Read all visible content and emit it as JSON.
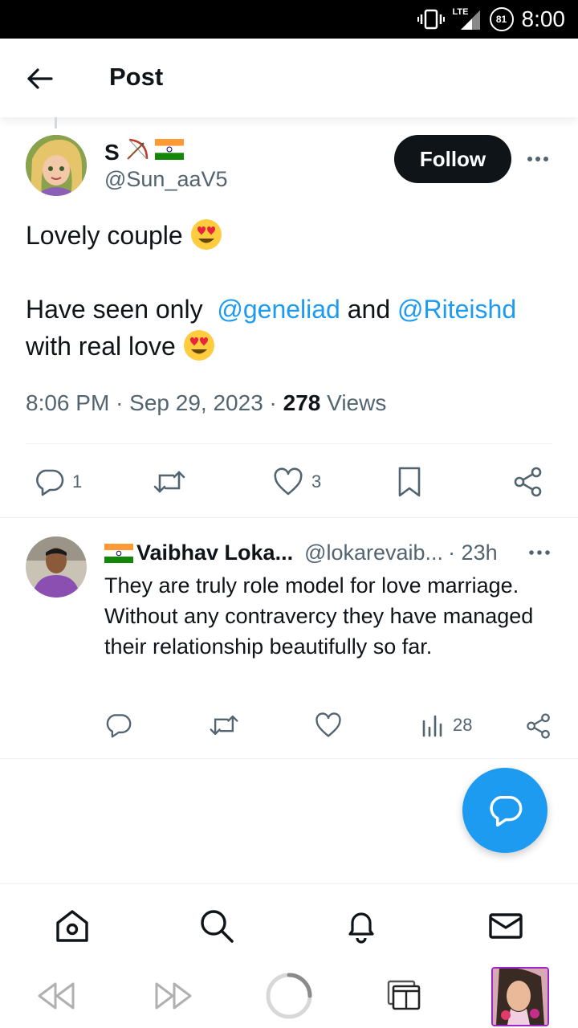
{
  "status_bar": {
    "network_label": "LTE",
    "battery_level": "81",
    "time": "8:00"
  },
  "header": {
    "title": "Post",
    "back_icon": "arrow-left-icon"
  },
  "post": {
    "author_name": "S",
    "author_handle": "@Sun_aaV5",
    "follow_label": "Follow",
    "line1": "Lovely couple",
    "line2_prefix": "Have seen only",
    "mention1": "@geneliad",
    "line2_mid": "and",
    "mention2": "@Riteishd",
    "line3": "with real love",
    "time": "8:06 PM",
    "sep1": "·",
    "date": "Sep 29, 2023",
    "sep2": "·",
    "views_count": "278",
    "views_label": "Views",
    "actions": {
      "reply_count": "1",
      "retweet_count": "",
      "like_count": "3"
    }
  },
  "reply": {
    "name": "Vaibhav Loka...",
    "handle": "@lokarevaib...",
    "time": "· 23h",
    "text": "They are truly role model for love marriage. Without any contravercy they have managed their relationship beautifully so far.",
    "views_count": "28"
  },
  "colors": {
    "accent": "#1d9bf0",
    "text_primary": "#0f1419",
    "text_secondary": "#536471",
    "thumb_border": "#9b27c9"
  }
}
